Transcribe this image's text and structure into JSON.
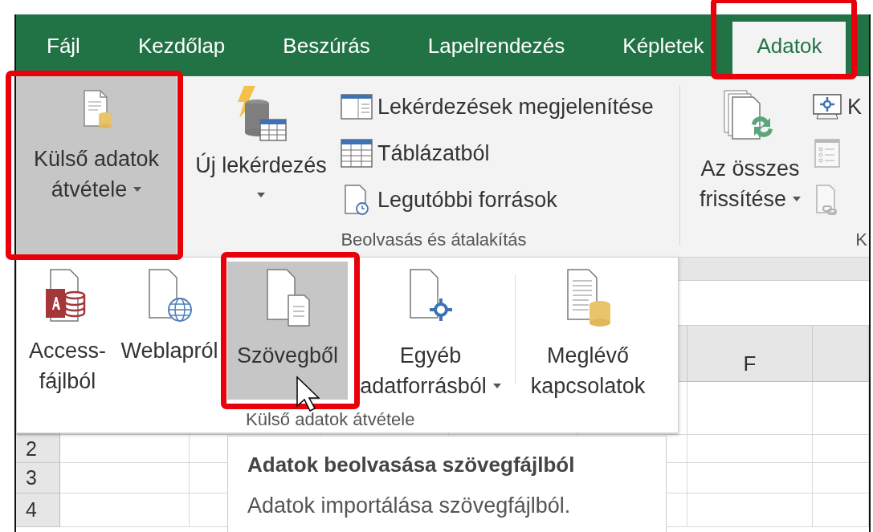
{
  "tabs": [
    {
      "label": "Fájl",
      "selected": false,
      "highlighted": false
    },
    {
      "label": "Kezdőlap",
      "selected": false,
      "highlighted": false
    },
    {
      "label": "Beszúrás",
      "selected": false,
      "highlighted": false
    },
    {
      "label": "Lapelrendezés",
      "selected": false,
      "highlighted": false
    },
    {
      "label": "Képletek",
      "selected": false,
      "highlighted": false
    },
    {
      "label": "Adatok",
      "selected": true,
      "highlighted": true
    }
  ],
  "external_data_button": {
    "lines": [
      "Külső adatok",
      "átvétele"
    ],
    "pressed": true,
    "dropdown": true,
    "highlighted": true
  },
  "get_transform_group": {
    "new_query": {
      "label": "Új lekérdezés",
      "dropdown": true
    },
    "items": [
      {
        "label": "Lekérdezések megjelenítése"
      },
      {
        "label": "Táblázatból"
      },
      {
        "label": "Legutóbbi források"
      }
    ],
    "label": "Beolvasás és átalakítás"
  },
  "connections_group": {
    "refresh_all": {
      "lines": [
        "Az összes",
        "frissítése"
      ],
      "dropdown": true
    },
    "items": [
      {
        "label": "K",
        "disabled": false
      },
      {
        "disabled": true
      },
      {
        "disabled": true
      }
    ],
    "label": "K"
  },
  "dropdown_menu": {
    "items": [
      {
        "lines": [
          "Access-",
          "fájlból"
        ],
        "selected": false,
        "dropdown": false,
        "highlighted": false
      },
      {
        "lines": [
          "Weblapról"
        ],
        "selected": false,
        "dropdown": false,
        "highlighted": false
      },
      {
        "lines": [
          "Szövegből"
        ],
        "selected": true,
        "dropdown": false,
        "highlighted": true
      },
      {
        "lines": [
          "Egyéb",
          "adatforrásból"
        ],
        "selected": false,
        "dropdown": true,
        "highlighted": false
      },
      {
        "lines": [
          "Meglévő",
          "kapcsolatok"
        ],
        "selected": false,
        "dropdown": false,
        "highlighted": false
      }
    ],
    "label": "Külső adatok átvétele"
  },
  "tooltip": {
    "title": "Adatok beolvasása szövegfájlból",
    "description": "Adatok importálása szövegfájlból."
  },
  "sheet": {
    "columns": [
      "F"
    ],
    "rows": [
      "2",
      "3",
      "4"
    ]
  }
}
